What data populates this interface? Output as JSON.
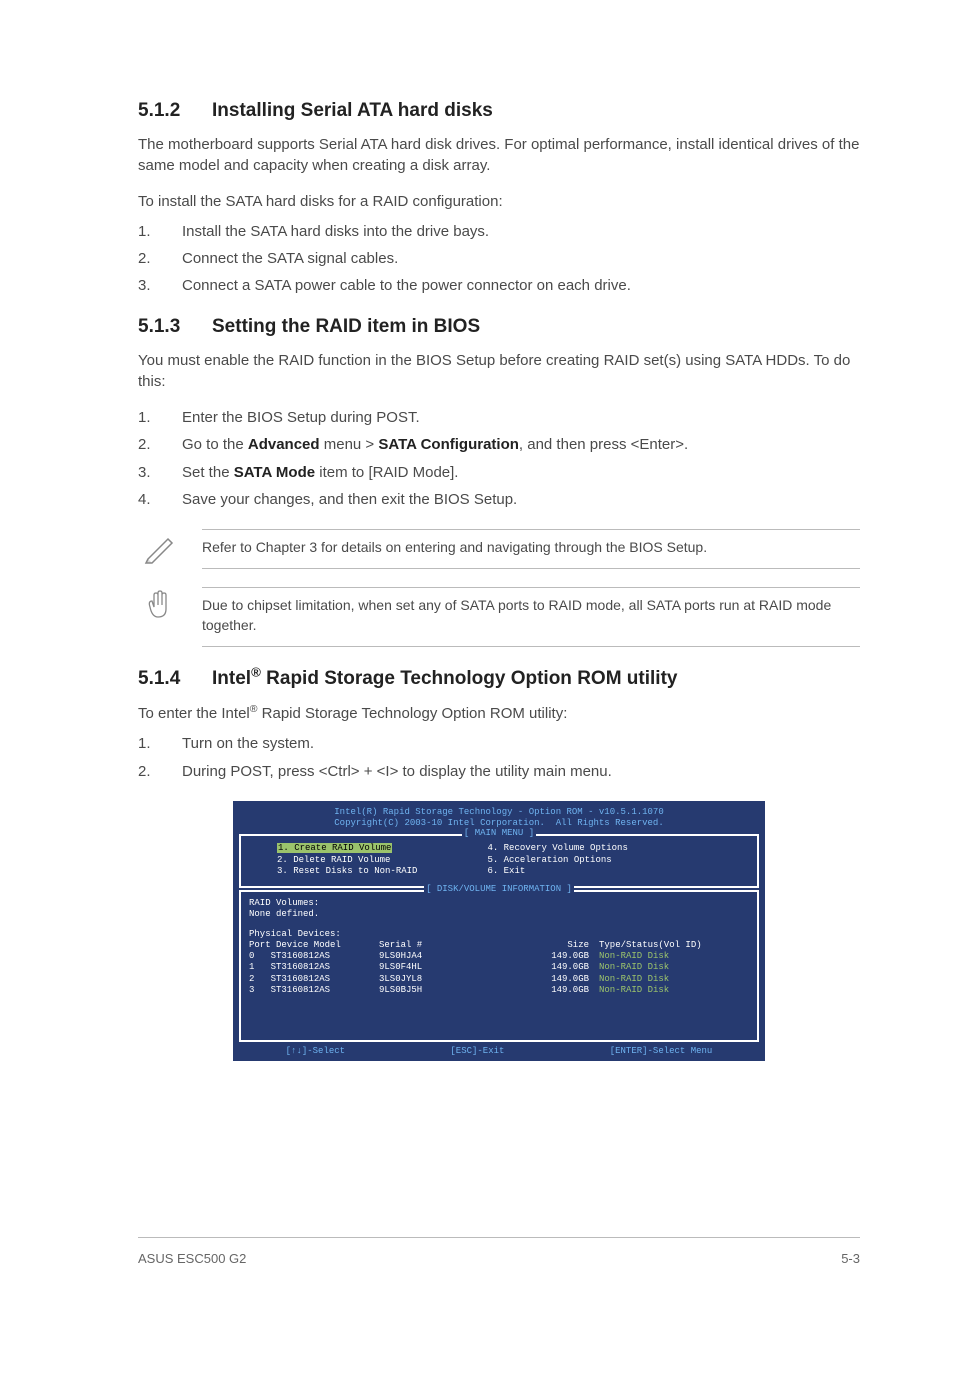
{
  "sec512": {
    "num": "5.1.2",
    "title": "Installing Serial ATA hard disks",
    "body": "The motherboard supports Serial ATA hard disk drives. For optimal performance, install identical drives of the same model and capacity when creating a disk array.",
    "intro": "To install the SATA hard disks for a RAID configuration:",
    "steps": [
      "Install the SATA hard disks into the drive bays.",
      "Connect the SATA signal cables.",
      "Connect a SATA power cable to the power connector on each drive."
    ]
  },
  "sec513": {
    "num": "5.1.3",
    "title": "Setting the RAID item in BIOS",
    "body": "You must enable the RAID function in the BIOS Setup before creating RAID set(s) using SATA HDDs. To do this:",
    "steps": [
      {
        "n": "1.",
        "text": "Enter the BIOS Setup during POST."
      },
      {
        "n": "2.",
        "pre": "Go to the ",
        "b1": "Advanced",
        "mid": " menu > ",
        "b2": "SATA Configuration",
        "post": ", and then press <Enter>."
      },
      {
        "n": "3.",
        "pre": "Set the ",
        "b1": "SATA Mode",
        "post": " item to [RAID Mode]."
      },
      {
        "n": "4.",
        "text": "Save your changes, and then exit the BIOS Setup."
      }
    ],
    "note1": "Refer to Chapter 3 for details on entering and navigating through the BIOS Setup.",
    "note2": "Due to chipset limitation, when set any of SATA ports to RAID mode, all SATA ports run at RAID mode together."
  },
  "sec514": {
    "num": "5.1.4",
    "title_pre": "Intel",
    "title_post": " Rapid Storage Technology Option ROM utility",
    "intro_pre": "To enter the Intel",
    "intro_post": " Rapid Storage Technology Option ROM utility:",
    "steps": [
      "Turn on the system.",
      "During POST, press <Ctrl> + <I> to display the utility main menu."
    ]
  },
  "bios": {
    "hdr1": "Intel(R) Rapid Storage Technology - Option ROM - v10.5.1.1070",
    "hdr2": "Copyright(C) 2003-10 Intel Corporation.  All Rights Reserved.",
    "mainmenu_label": "[ MAIN MENU ]",
    "menu_left": [
      {
        "sel": true,
        "text": "1. Create RAID Volume"
      },
      {
        "sel": false,
        "text": "2. Delete RAID Volume"
      },
      {
        "sel": false,
        "text": "3. Reset Disks to Non-RAID"
      }
    ],
    "menu_right": [
      "4. Recovery Volume Options",
      "5. Acceleration Options",
      "6. Exit"
    ],
    "info_label": "[ DISK/VOLUME INFORMATION ]",
    "raid_vol": "RAID Volumes:",
    "none": "None defined.",
    "phys": "Physical Devices:",
    "thead": {
      "port": "Port Device Model",
      "serial": "Serial #",
      "size": "Size",
      "type": "Type/Status(Vol ID)"
    },
    "rows": [
      {
        "port": "0",
        "model": "ST3160812AS",
        "serial": "9LS0HJA4",
        "size": "149.0GB",
        "type": "Non-RAID Disk"
      },
      {
        "port": "1",
        "model": "ST3160812AS",
        "serial": "9LS0F4HL",
        "size": "149.0GB",
        "type": "Non-RAID Disk"
      },
      {
        "port": "2",
        "model": "ST3160812AS",
        "serial": "3LS0JYL8",
        "size": "149.0GB",
        "type": "Non-RAID Disk"
      },
      {
        "port": "3",
        "model": "ST3160812AS",
        "serial": "9LS0BJ5H",
        "size": "149.0GB",
        "type": "Non-RAID Disk"
      }
    ],
    "foot": {
      "select": "[↑↓]-Select",
      "exit": "[ESC]-Exit",
      "enter": "[ENTER]-Select Menu"
    }
  },
  "footer": {
    "left": "ASUS ESC500 G2",
    "right": "5-3"
  }
}
